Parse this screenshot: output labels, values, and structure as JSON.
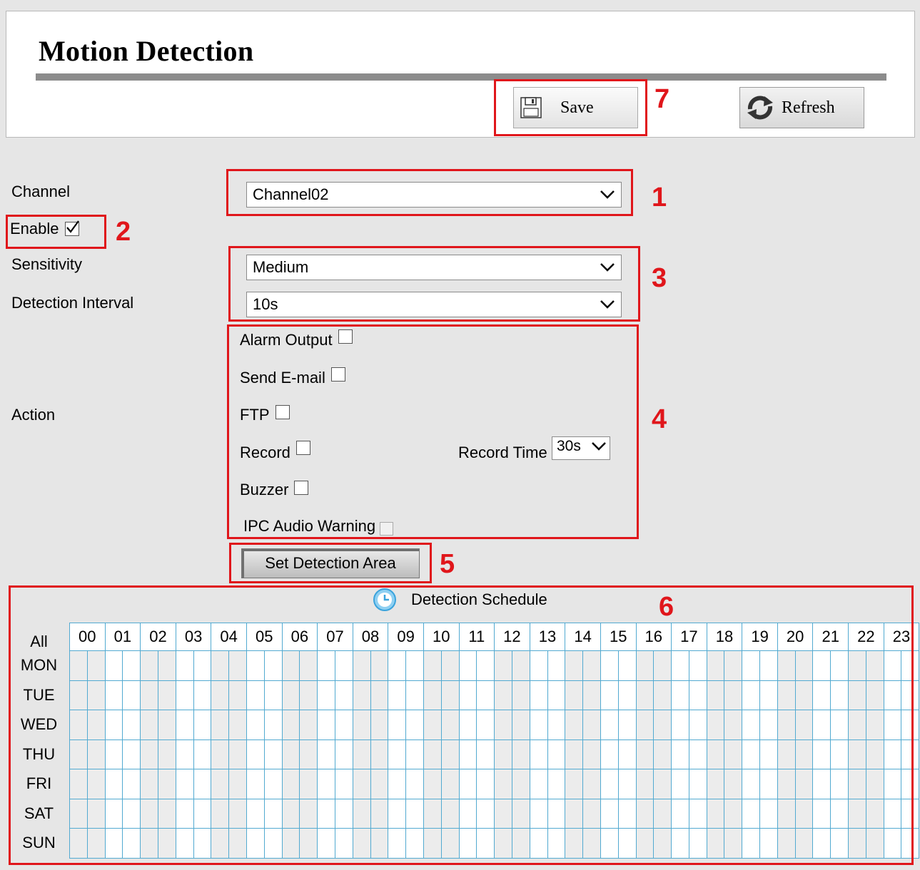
{
  "header": {
    "title": "Motion Detection",
    "save_label": "Save",
    "refresh_label": "Refresh"
  },
  "form": {
    "channel_label": "Channel",
    "channel_value": "Channel02",
    "enable_label": "Enable",
    "enable_checked": true,
    "sensitivity_label": "Sensitivity",
    "sensitivity_value": "Medium",
    "interval_label": "Detection Interval",
    "interval_value": "10s",
    "action_label": "Action",
    "actions": {
      "alarm_output": "Alarm Output",
      "send_email": "Send E-mail",
      "ftp": "FTP",
      "record": "Record",
      "buzzer": "Buzzer",
      "ipc_audio": "IPC Audio Warning"
    },
    "record_time_label": "Record Time",
    "record_time_value": "30s",
    "set_area_label": "Set Detection Area"
  },
  "schedule": {
    "title": "Detection Schedule",
    "all_label": "All",
    "days": [
      "MON",
      "TUE",
      "WED",
      "THU",
      "FRI",
      "SAT",
      "SUN"
    ],
    "hours": [
      "00",
      "01",
      "02",
      "03",
      "04",
      "05",
      "06",
      "07",
      "08",
      "09",
      "10",
      "11",
      "12",
      "13",
      "14",
      "15",
      "16",
      "17",
      "18",
      "19",
      "20",
      "21",
      "22",
      "23"
    ]
  },
  "annotations": {
    "n1": "1",
    "n2": "2",
    "n3": "3",
    "n4": "4",
    "n5": "5",
    "n6": "6",
    "n7": "7"
  },
  "colors": {
    "annotation_red": "#e0161b",
    "grid_blue": "#52aad1",
    "panel_bg": "#e6e6e6"
  }
}
